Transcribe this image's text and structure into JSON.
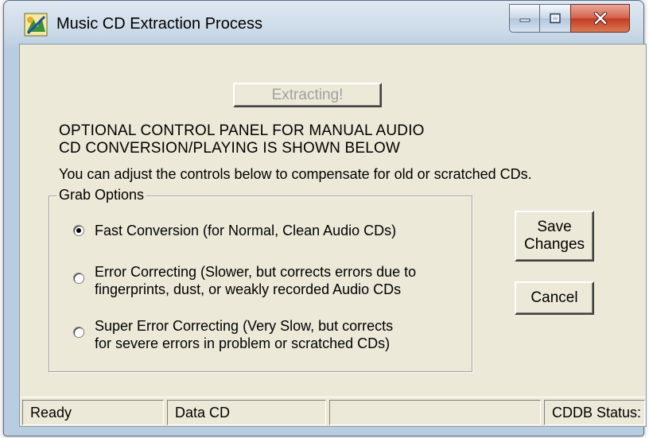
{
  "window": {
    "title": "Music CD Extraction Process",
    "icon": "music-cd-app-icon"
  },
  "caption_buttons": {
    "minimize_icon": "minimize-icon",
    "maximize_icon": "maximize-icon",
    "close_icon": "close-icon"
  },
  "main": {
    "extract_button": "Extracting!",
    "heading": "OPTIONAL CONTROL PANEL FOR MANUAL AUDIO\nCD CONVERSION/PLAYING IS SHOWN BELOW",
    "instruction": "You can adjust the controls below to compensate for old or scratched CDs."
  },
  "grab_options": {
    "label": "Grab Options",
    "options": [
      {
        "label": "Fast Conversion (for Normal, Clean Audio CDs)",
        "checked": true
      },
      {
        "label": "Error Correcting (Slower, but corrects errors due to\nfingerprints, dust, or weakly recorded Audio CDs",
        "checked": false
      },
      {
        "label": "Super Error Correcting (Very Slow, but corrects\nfor severe errors in problem  or scratched CDs)",
        "checked": false
      }
    ]
  },
  "buttons": {
    "save": "Save\nChanges",
    "cancel": "Cancel"
  },
  "status_bar": {
    "status": "Ready",
    "disc_type": "Data CD",
    "middle": "",
    "cddb": "CDDB Status:"
  }
}
